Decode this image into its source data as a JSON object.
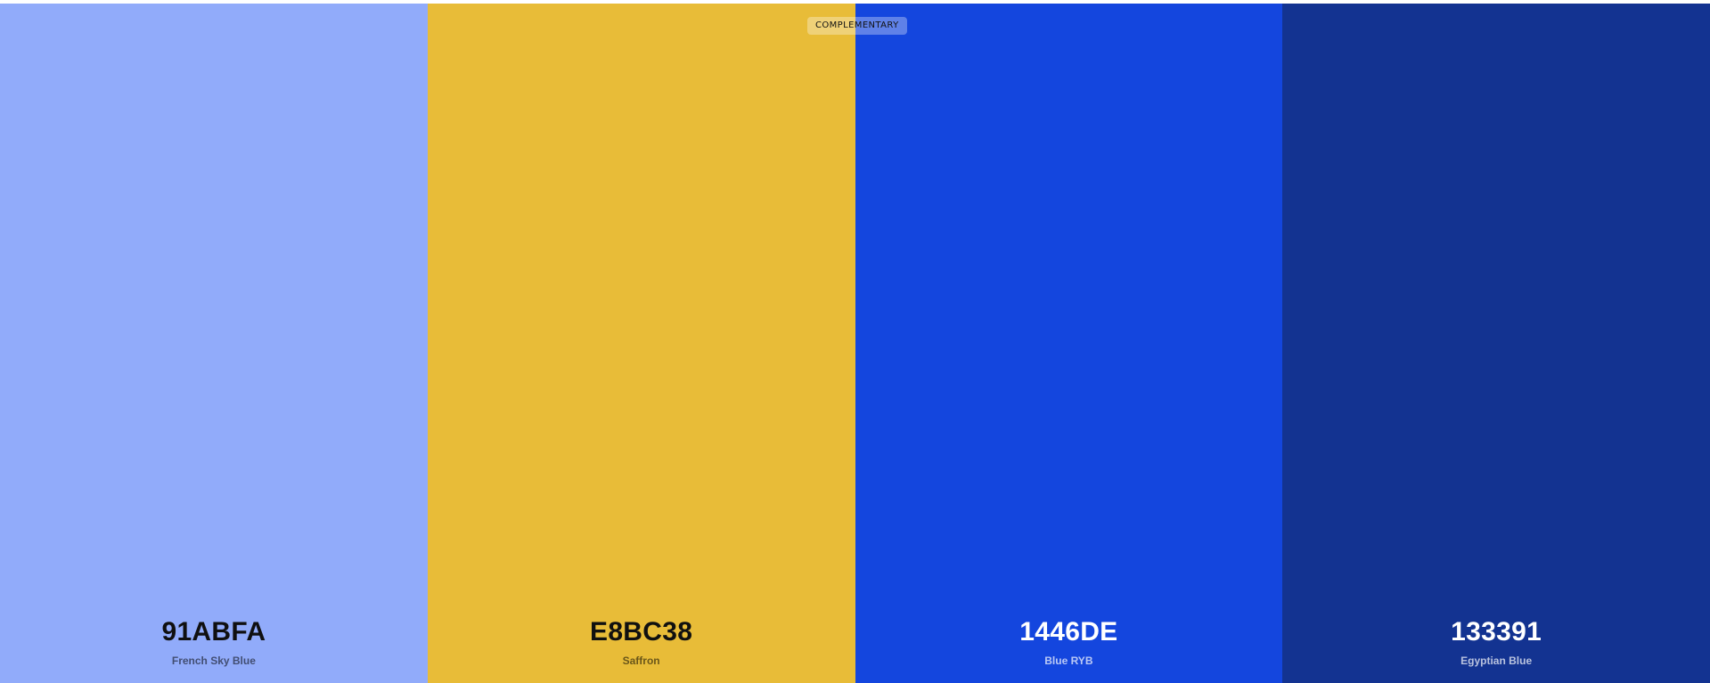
{
  "badge": {
    "label": "COMPLEMENTARY"
  },
  "swatches": [
    {
      "hex": "91ABFA",
      "name": "French Sky Blue",
      "color": "#91ABFA",
      "text_tone": "dark"
    },
    {
      "hex": "E8BC38",
      "name": "Saffron",
      "color": "#E8BC38",
      "text_tone": "dark"
    },
    {
      "hex": "1446DE",
      "name": "Blue RYB",
      "color": "#1446DE",
      "text_tone": "light"
    },
    {
      "hex": "133391",
      "name": "Egyptian Blue",
      "color": "#133391",
      "text_tone": "light"
    }
  ]
}
